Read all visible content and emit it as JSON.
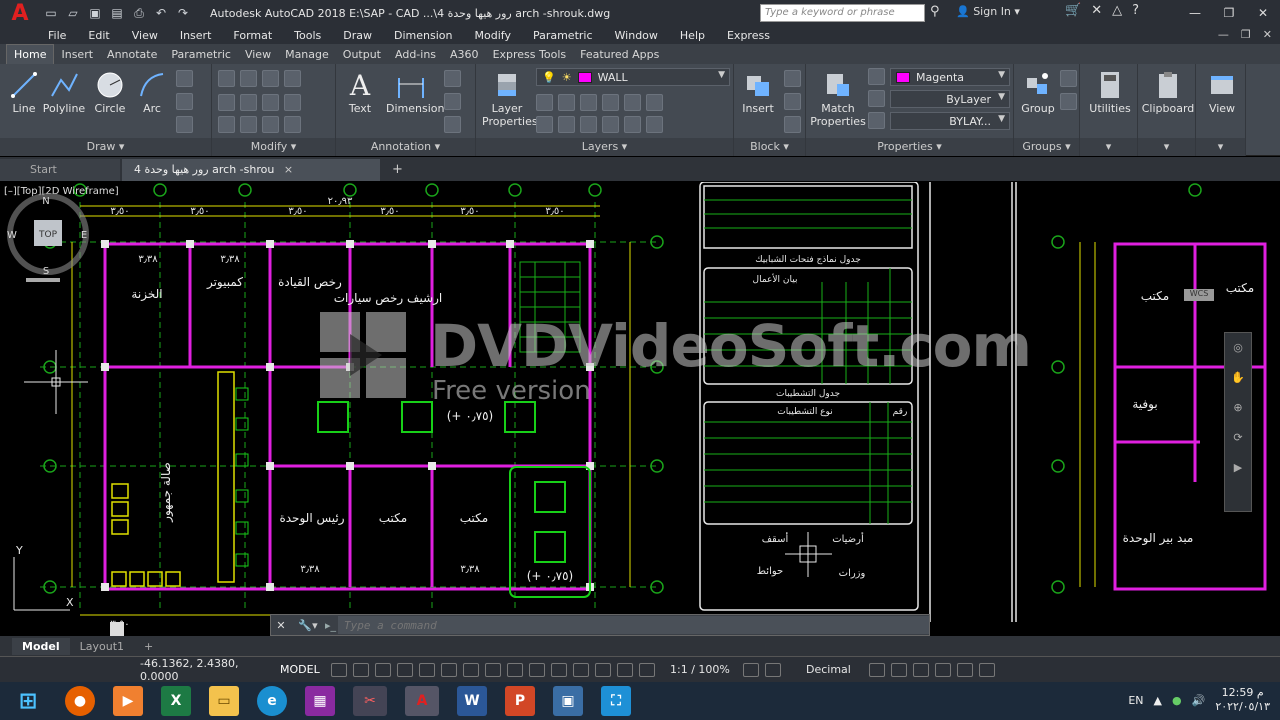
{
  "titlebar": {
    "title": "Autodesk AutoCAD 2018    E:\\SAP  - CAD ...\\4  رور هيها  وحدة  arch  -shrouk.dwg",
    "search_placeholder": "Type a keyword or phrase",
    "signin": "Sign In",
    "quick_access_icons": [
      "new-icon",
      "open-icon",
      "save-icon",
      "saveas-icon",
      "plot-icon",
      "undo-icon",
      "redo-icon"
    ]
  },
  "menubar": [
    "File",
    "Edit",
    "View",
    "Insert",
    "Format",
    "Tools",
    "Draw",
    "Dimension",
    "Modify",
    "Parametric",
    "Window",
    "Help",
    "Express"
  ],
  "ribbon_tabs": [
    "Home",
    "Insert",
    "Annotate",
    "Parametric",
    "View",
    "Manage",
    "Output",
    "Add-ins",
    "A360",
    "Express Tools",
    "Featured Apps"
  ],
  "ribbon": {
    "draw": {
      "title": "Draw",
      "tools": [
        "Line",
        "Polyline",
        "Circle",
        "Arc"
      ]
    },
    "modify": {
      "title": "Modify"
    },
    "annotation": {
      "title": "Annotation",
      "tools": [
        "Text",
        "Dimension"
      ]
    },
    "layers": {
      "title": "Layers",
      "tool": "Layer Properties",
      "current_layer": "WALL",
      "layer_color": "#ff00ff"
    },
    "block": {
      "title": "Block",
      "tool": "Insert"
    },
    "properties": {
      "title": "Properties",
      "tool": "Match Properties",
      "color": "Magenta",
      "linetype": "ByLayer",
      "lineweight": "BYLAY..."
    },
    "groups": {
      "title": "Groups",
      "tool": "Group"
    },
    "utilities": "Utilities",
    "clipboard": "Clipboard",
    "view": "View"
  },
  "file_tabs": [
    "Start",
    "4  رور هيها  وحدة  arch  -shrou"
  ],
  "viewport_label": "[–][Top][2D Wireframe]",
  "drawing": {
    "rooms": [
      "الخزنة",
      "كمبيوتر",
      "رخص القيادة",
      "ارشيف رخص سيارات",
      "صالة جمهور",
      "رئيس الوحدة",
      "مكتب",
      "مكتب",
      "مكتب",
      "بوفية",
      "مبد بير الوحدة",
      "مكتب"
    ],
    "level_mark_1": "(+ ٠٫٧٥)",
    "level_mark_2": "(+ ٠٫٧٥)",
    "dim_top": "٢٠٫٩٣",
    "dims": [
      "٣٫٥٠",
      "٣٫٥٠",
      "٣٫٥٠",
      "٣٫٥٠",
      "٣٫٥٠",
      "٣٫٥٠",
      "٣٫٥٠",
      "٣٫٣٨",
      "٣٫٣٨",
      "٣٫٣٨",
      "٣٫٣٨"
    ],
    "table_titles": [
      "جدول نماذج فتحات الشبابيك",
      "جدول التشطيبات"
    ],
    "table_headers": [
      "بيان الأعمال",
      "رقم",
      "نوع التشطيبات"
    ],
    "legend_labels": [
      "أسقف",
      "أرضيات",
      "حوائط",
      "وزرات"
    ],
    "viewcube": {
      "top": "TOP",
      "n": "N",
      "s": "S",
      "e": "E",
      "w": "W",
      "wcs": "WCS"
    }
  },
  "watermark": {
    "main": "DVDVideoSoft.com",
    "sub": "Free version"
  },
  "command": {
    "placeholder": "Type a command"
  },
  "layout_tabs": [
    "Model",
    "Layout1"
  ],
  "status": {
    "coords": "-46.1362, 2.4380, 0.0000",
    "model": "MODEL",
    "scale": "1:1 / 100%",
    "units": "Decimal"
  },
  "taskbar": {
    "apps": [
      "firefox",
      "media-player",
      "excel",
      "explorer",
      "edge",
      "rar",
      "snipping",
      "autocad",
      "word",
      "powerpoint",
      "photos",
      "capture"
    ],
    "lang": "EN",
    "time": "12:59 م",
    "date": "٢٠٢٢/٠٥/١٣"
  }
}
